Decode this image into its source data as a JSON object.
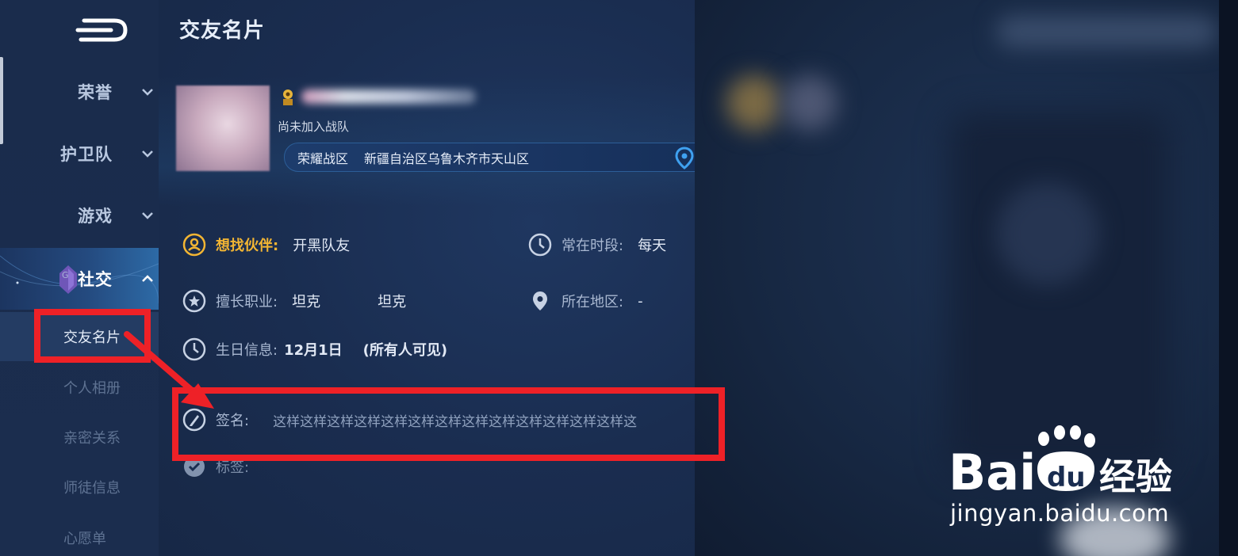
{
  "sidebar": {
    "categories": [
      {
        "label": "荣誉",
        "icon": "chevron-down-icon"
      },
      {
        "label": "护卫队",
        "icon": "chevron-down-icon"
      },
      {
        "label": "游戏",
        "icon": "chevron-down-icon"
      },
      {
        "label": "社交",
        "icon": "chevron-up-icon"
      }
    ],
    "social_badge_letter": "G",
    "sub_items": [
      "交友名片",
      "个人相册",
      "亲密关系",
      "师徒信息",
      "心愿单"
    ]
  },
  "main": {
    "title": "交友名片",
    "profile": {
      "team_status": "尚未加入战队",
      "zone": "荣耀战区",
      "region": "新疆自治区乌鲁木齐市天山区"
    },
    "info": {
      "partner_label": "想找伙伴:",
      "partner_value": "开黑队友",
      "time_label": "常在时段:",
      "time_value": "每天",
      "role_label": "擅长职业:",
      "role_value_1": "坦克",
      "role_value_2": "坦克",
      "area_label": "所在地区:",
      "area_value": "-",
      "birthday_label": "生日信息:",
      "birthday_value": "12月1日",
      "birthday_visibility": "(所有人可见)",
      "signature_label": "签名:",
      "signature_value": "这样这样这样这样这样这样这样这样这样这样这样这样这样这",
      "tags_label": "标签:"
    }
  },
  "watermark": {
    "text": "Baidu经验",
    "url": "jingyan.baidu.com"
  },
  "colors": {
    "accent_gold": "#f2b533",
    "annotation_red": "#ee2127",
    "background": "#15223d"
  }
}
